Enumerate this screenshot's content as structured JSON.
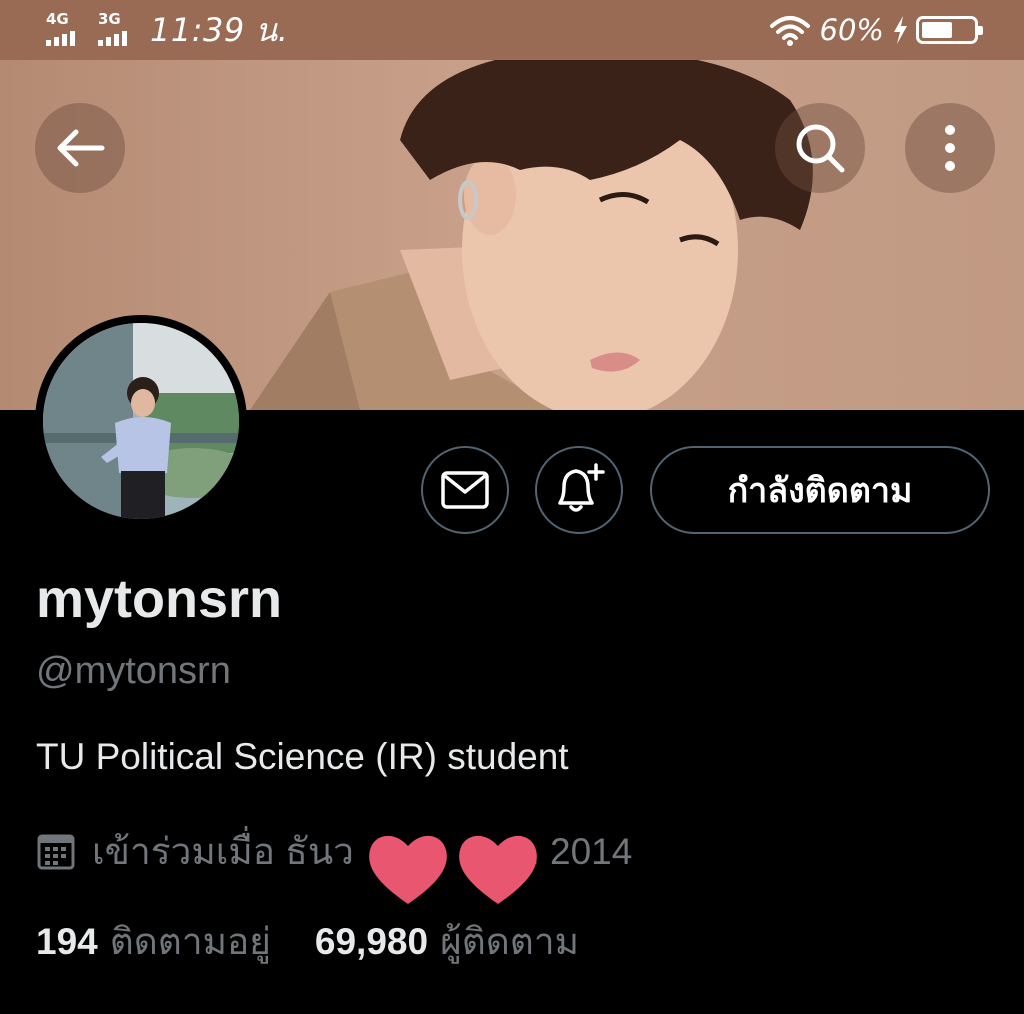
{
  "status_bar": {
    "network_1": "4G",
    "network_2": "3G",
    "time": "11:39 น.",
    "battery_percent": "60%",
    "battery_level": 0.6
  },
  "profile": {
    "display_name": "mytonsrn",
    "handle": "@mytonsrn",
    "bio": "TU Political Science (IR) student",
    "joined": "เข้าร่วมเมื่อ ธันว",
    "joined_end": "ศ. 2014",
    "following_count": "194",
    "following_label": "ติดตามอยู่",
    "followers_count": "69,980",
    "followers_label": "ผู้ติดตาม"
  },
  "actions": {
    "follow_label": "กำลังติดตาม",
    "back_icon": "back-arrow-icon",
    "search_icon": "search-icon",
    "more_icon": "more-vertical-icon",
    "message_icon": "mail-icon",
    "notify_icon": "bell-plus-icon"
  },
  "colors": {
    "status_bar": "#9a6b54",
    "banner": "#bf957c",
    "background": "#000000",
    "primary_text": "#e7e9ea",
    "secondary_text": "#71767b",
    "button_border": "#536471",
    "heart": "#e8566f"
  }
}
